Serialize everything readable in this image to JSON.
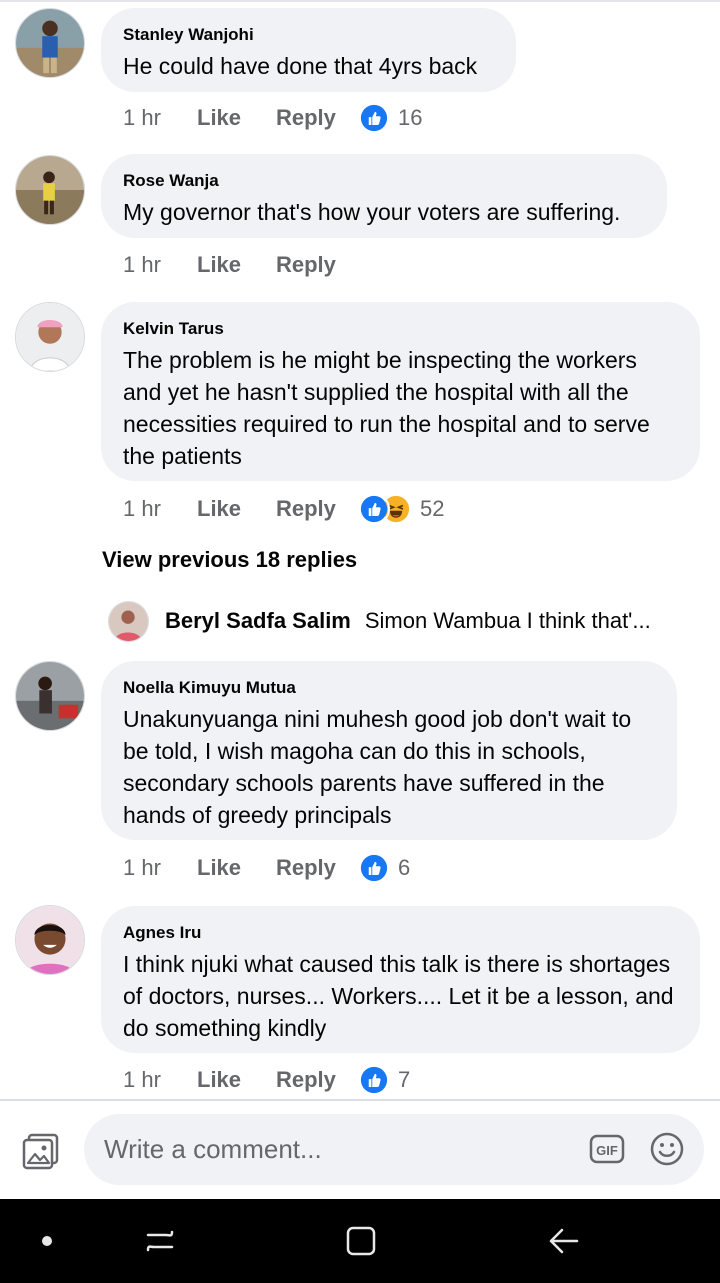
{
  "comments": [
    {
      "name": "Stanley Wanjohi",
      "text": "He could have done that 4yrs back",
      "time": "1 hr",
      "like": "Like",
      "reply": "Reply",
      "reactions": "16"
    },
    {
      "name": "Rose Wanja",
      "text": "My governor that's how your voters are suffering.",
      "time": "1 hr",
      "like": "Like",
      "reply": "Reply",
      "reactions": ""
    },
    {
      "name": "Kelvin Tarus",
      "text": "The problem is he might be inspecting the workers and  yet he hasn't supplied the hospital with all the necessities required to run the hospital and to serve the patients",
      "time": "1 hr",
      "like": "Like",
      "reply": "Reply",
      "reactions": "52"
    },
    {
      "name": "Noella Kimuyu Mutua",
      "text": "Unakunyuanga nini muhesh good job don't wait to be told, I wish magoha can do this in schools, secondary schools parents have suffered in the hands of greedy principals",
      "time": "1 hr",
      "like": "Like",
      "reply": "Reply",
      "reactions": "6"
    },
    {
      "name": "Agnes Iru",
      "text": "I think njuki   what caused this talk is there is shortages of doctors, nurses... Workers.... Let it be a lesson, and do something kindly",
      "time": "1 hr",
      "like": "Like",
      "reply": "Reply",
      "reactions": "7"
    }
  ],
  "view_previous": "View previous 18 replies",
  "reply_preview": {
    "name": "Beryl Sadfa Salim",
    "text": "Simon Wambua I think that'..."
  },
  "composer": {
    "placeholder": "Write a comment...",
    "gif": "GIF"
  },
  "icons": {
    "like": "like-reaction-icon",
    "haha": "haha-reaction-icon",
    "photo": "photo-icon",
    "gif": "gif-icon",
    "emoji": "emoji-icon"
  },
  "colors": {
    "like_blue": "#1877f2",
    "haha_yellow": "#f7b125",
    "bubble": "#f0f2f5",
    "meta_text": "#65676b"
  }
}
